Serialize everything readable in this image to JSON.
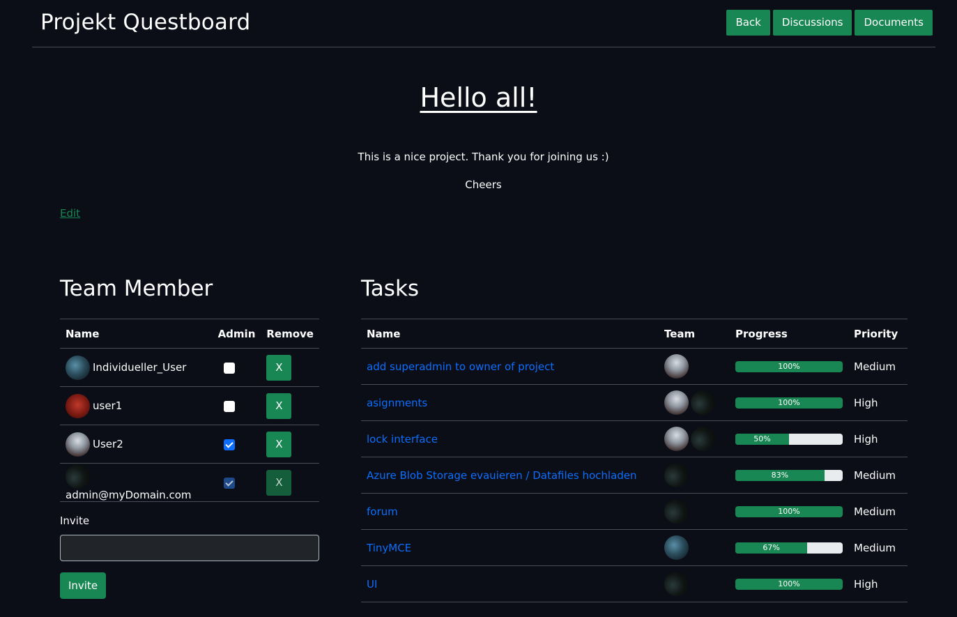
{
  "header": {
    "title": "Projekt Questboard",
    "buttons": [
      "Back",
      "Discussions",
      "Documents"
    ]
  },
  "welcome": {
    "heading": "Hello all! ",
    "lines": [
      "This is a nice project. Thank you for joining us :)",
      "Cheers"
    ],
    "edit_label": "Edit"
  },
  "team": {
    "title": "Team Member",
    "columns": [
      "Name",
      "Admin",
      "Remove"
    ],
    "members": [
      {
        "name": "Individueller_User",
        "admin": false,
        "remove_label": "X",
        "avatar": "avatar-landscape"
      },
      {
        "name": "user1",
        "admin": false,
        "remove_label": "X",
        "avatar": "avatar-red"
      },
      {
        "name": "User2",
        "admin": true,
        "remove_label": "X",
        "avatar": "avatar-biker"
      },
      {
        "name": "admin@myDomain.com",
        "admin": true,
        "remove_label": "X",
        "avatar": "avatar-dark",
        "locked": true
      }
    ],
    "invite_label": "Invite",
    "invite_placeholder": "",
    "invite_button": "Invite"
  },
  "tasks": {
    "title": "Tasks",
    "columns": [
      "Name",
      "Team",
      "Progress",
      "Priority"
    ],
    "rows": [
      {
        "name": "add superadmin to owner of project",
        "team": [
          "avatar-biker"
        ],
        "progress": 100,
        "progress_label": "100%",
        "priority": "Medium"
      },
      {
        "name": "asignments",
        "team": [
          "avatar-biker",
          "avatar-dark"
        ],
        "progress": 100,
        "progress_label": "100%",
        "priority": "High"
      },
      {
        "name": "lock interface",
        "team": [
          "avatar-biker",
          "avatar-dark"
        ],
        "progress": 50,
        "progress_label": "50%",
        "priority": "High"
      },
      {
        "name": "Azure Blob Storage evauieren / Datafiles hochladen",
        "team": [
          "avatar-dark"
        ],
        "progress": 83,
        "progress_label": "83%",
        "priority": "Medium"
      },
      {
        "name": "forum",
        "team": [
          "avatar-dark"
        ],
        "progress": 100,
        "progress_label": "100%",
        "priority": "Medium"
      },
      {
        "name": "TinyMCE",
        "team": [
          "avatar-landscape"
        ],
        "progress": 67,
        "progress_label": "67%",
        "priority": "Medium"
      },
      {
        "name": "UI",
        "team": [
          "avatar-dark"
        ],
        "progress": 100,
        "progress_label": "100%",
        "priority": "High"
      }
    ]
  },
  "colors": {
    "accent": "#198754",
    "link": "#0d6efd",
    "background": "#0b0e16"
  }
}
